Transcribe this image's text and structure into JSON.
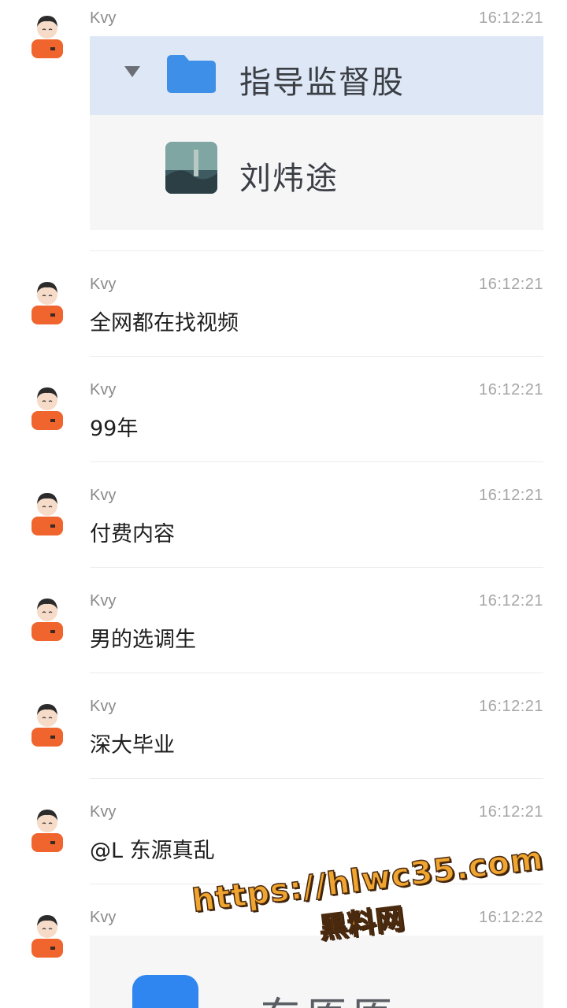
{
  "messages": [
    {
      "sender": "Kvy",
      "time": "16:12:21",
      "type": "card",
      "card": {
        "group_name": "指导监督股",
        "member_name": "刘炜途"
      }
    },
    {
      "sender": "Kvy",
      "time": "16:12:21",
      "type": "text",
      "text": "全网都在找视频"
    },
    {
      "sender": "Kvy",
      "time": "16:12:21",
      "type": "text",
      "text": "99年"
    },
    {
      "sender": "Kvy",
      "time": "16:12:21",
      "type": "text",
      "text": "付费内容"
    },
    {
      "sender": "Kvy",
      "time": "16:12:21",
      "type": "text",
      "text": "男的选调生"
    },
    {
      "sender": "Kvy",
      "time": "16:12:21",
      "type": "text",
      "text": "深大毕业"
    },
    {
      "sender": "Kvy",
      "time": "16:12:21",
      "type": "text",
      "text": "@L 东源真乱"
    },
    {
      "sender": "Kvy",
      "time": "16:12:22",
      "type": "card-partial",
      "card": {
        "partial_text": "东原原"
      }
    }
  ],
  "watermark": {
    "url": "https://hlwc35.com",
    "name": "黑料网"
  },
  "colors": {
    "avatar_shirt": "#f0642d",
    "folder": "#3d8fe8",
    "selected_row": "#dde7f5",
    "watermark": "#f1a531"
  },
  "icons": {
    "avatar": "avatar-icon",
    "folder": "folder-icon",
    "caret": "caret-down-icon"
  }
}
